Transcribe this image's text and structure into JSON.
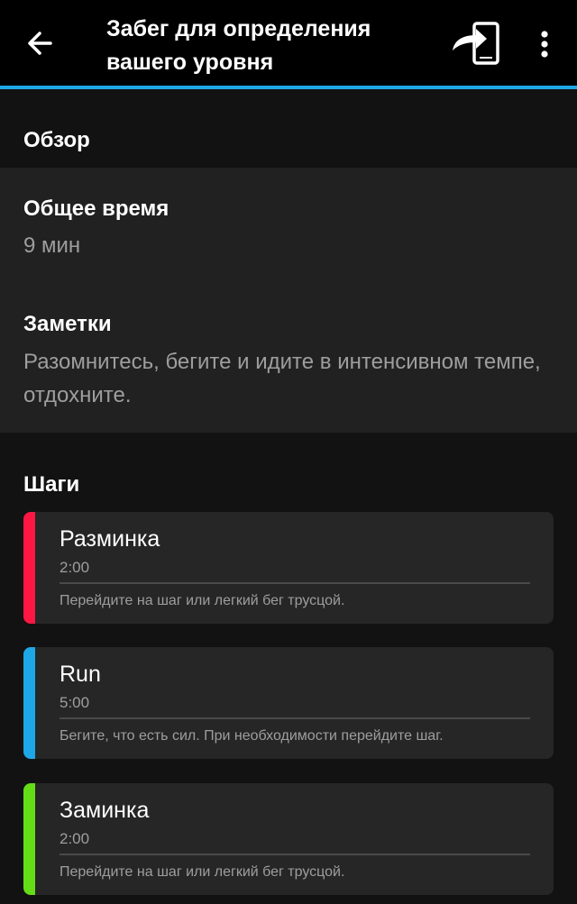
{
  "header": {
    "title": "Забег для определения вашего уровня",
    "back_icon": "arrow-left-icon",
    "share_icon": "send-to-device-icon",
    "more_icon": "more-vertical-icon",
    "accent_color": "#1ea7e6"
  },
  "overview": {
    "label": "Обзор",
    "total_time_label": "Общее время",
    "total_time_value": "9 мин",
    "notes_label": "Заметки",
    "notes_value": "Разомнитесь, бегите и идите в интенсивном темпе, отдохните."
  },
  "steps": {
    "label": "Шаги",
    "items": [
      {
        "name": "Разминка",
        "duration": "2:00",
        "description": "Перейдите на шаг или легкий бег трусцой.",
        "color": "#ff1744"
      },
      {
        "name": "Run",
        "duration": "5:00",
        "description": "Бегите, что есть сил. При необходимости перейдите шаг.",
        "color": "#1ea7e6"
      },
      {
        "name": "Заминка",
        "duration": "2:00",
        "description": "Перейдите на шаг или легкий бег трусцой.",
        "color": "#64dd17"
      }
    ]
  }
}
